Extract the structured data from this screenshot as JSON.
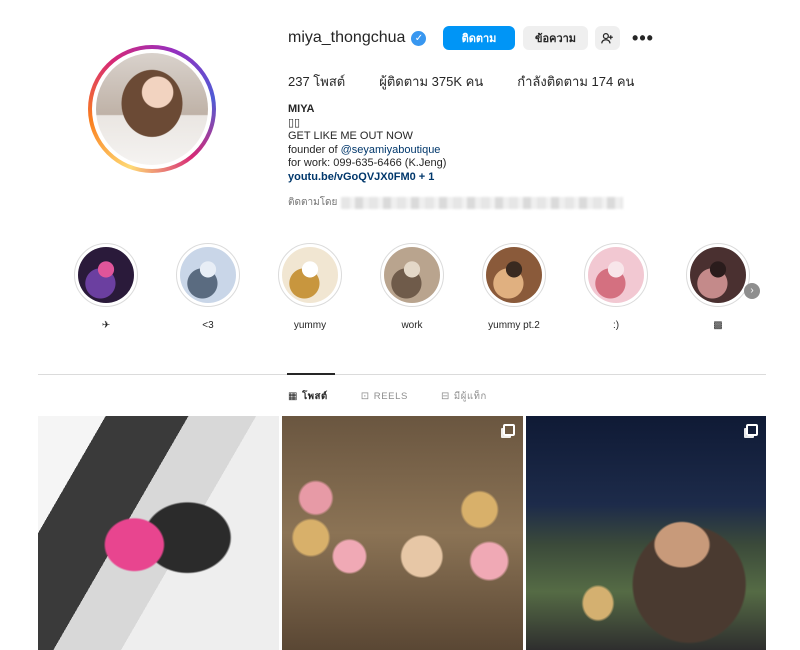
{
  "profile": {
    "username": "miya_thongchua",
    "follow_label": "ติดตาม",
    "message_label": "ข้อความ",
    "suggest_icon": "add-user-icon",
    "more_icon": "more-icon"
  },
  "stats": {
    "posts": "237 โพสต์",
    "followers": "ผู้ติดตาม 375K คน",
    "following": "กำลังติดตาม 174 คน"
  },
  "bio": {
    "name": "MIYA",
    "emoji_line": "▯▯",
    "line1": "GET LIKE ME OUT NOW",
    "founder_prefix": "founder of ",
    "founder_mention": "@seyamiyaboutique",
    "work": "for work: 099-635-6466 (K.Jeng)",
    "link": "youtu.be/vGoQVJX0FM0 + 1",
    "followed_by": "ติดตามโดย"
  },
  "highlights": [
    {
      "label": "✈",
      "colors": [
        "#2a1a3a",
        "#6b3fa0",
        "#e0559a"
      ]
    },
    {
      "label": "<3",
      "colors": [
        "#c9d6e8",
        "#5a6b80",
        "#e8eef6"
      ]
    },
    {
      "label": "yummy",
      "colors": [
        "#f1e6d2",
        "#c8963e",
        "#ffffff"
      ]
    },
    {
      "label": "work",
      "colors": [
        "#b9a48e",
        "#6f5b4a",
        "#e4d8c8"
      ]
    },
    {
      "label": "yummy pt.2",
      "colors": [
        "#8a5a3a",
        "#e0b080",
        "#3a2a20"
      ]
    },
    {
      "label": ":)",
      "colors": [
        "#f2c8d2",
        "#d47080",
        "#f8e6ea"
      ]
    },
    {
      "label": "▩",
      "colors": [
        "#4a3030",
        "#c48a8a",
        "#2a1c1c"
      ]
    }
  ],
  "tabs": [
    {
      "label": "โพสต์",
      "icon": "grid-icon"
    },
    {
      "label": "REELS",
      "icon": "reels-icon"
    },
    {
      "label": "มีผู้แท็ก",
      "icon": "tagged-icon"
    }
  ]
}
